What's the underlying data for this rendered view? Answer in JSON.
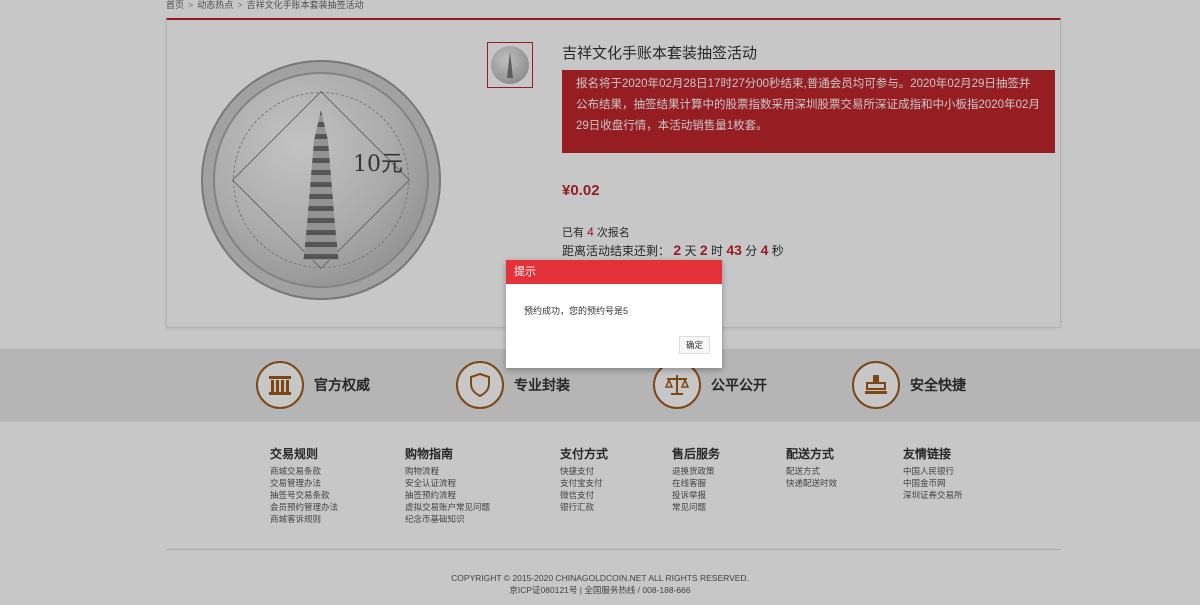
{
  "breadcrumb": [
    "首页",
    "动态热点",
    "吉祥文化手账本套装抽签活动"
  ],
  "product": {
    "title": "吉祥文化手账本套装抽签活动",
    "notice": "报名将于2020年02月28日17时27分00秒结束,普通会员均可参与。2020年02月29日抽签并公布结果，抽签结果计算中的股票指数采用深圳股票交易所深证成指和中小板指2020年02月29日收盘行情，本活动销售量1枚套。",
    "coin_value": "10元",
    "price": "¥0.02",
    "signups_prefix": "已有",
    "signups_count": "4",
    "signups_suffix": "次报名",
    "countdown_label": "距离活动结束还剩：",
    "countdown": {
      "days": "2",
      "days_unit": "天",
      "hours": "2",
      "hours_unit": "时",
      "minutes": "43",
      "minutes_unit": "分",
      "seconds": "4",
      "seconds_unit": "秒"
    }
  },
  "features": [
    {
      "label": "官方权威",
      "icon": "building-icon"
    },
    {
      "label": "专业封装",
      "icon": "shield-icon"
    },
    {
      "label": "公平公开",
      "icon": "scale-icon"
    },
    {
      "label": "安全快捷",
      "icon": "stamp-icon"
    }
  ],
  "footer_columns": [
    {
      "title": "交易规则",
      "links": [
        "商城交易条款",
        "交易管理办法",
        "抽签号交易条款",
        "会员预约管理办法",
        "商城客诉规则"
      ]
    },
    {
      "title": "购物指南",
      "links": [
        "购物流程",
        "安全认证流程",
        "抽签预约流程",
        "虚拟交易账户常见问题",
        "纪念币基础知识"
      ]
    },
    {
      "title": "支付方式",
      "links": [
        "快捷支付",
        "支付宝支付",
        "微信支付",
        "银行汇款"
      ]
    },
    {
      "title": "售后服务",
      "links": [
        "退换货政策",
        "在线客服",
        "投诉举报",
        "常见问题"
      ]
    },
    {
      "title": "配送方式",
      "links": [
        "配送方式",
        "快递配送时效"
      ]
    },
    {
      "title": "友情链接",
      "links": [
        "中国人民银行",
        "中国金币网",
        "深圳证券交易所"
      ]
    }
  ],
  "copyright": {
    "line1": "COPYRIGHT © 2015-2020 CHINAGOLDCOIN.NET ALL RIGHTS RESERVED.",
    "line2": "京ICP证080121号 | 全国服务热线 / 008-188-666"
  },
  "dialog": {
    "title": "提示",
    "message": "预约成功，您的预约号是5",
    "ok_label": "确定"
  },
  "colors": {
    "accent": "#c0272d",
    "dialog_header": "#e3323a",
    "feature_icon": "#a05a1c"
  }
}
